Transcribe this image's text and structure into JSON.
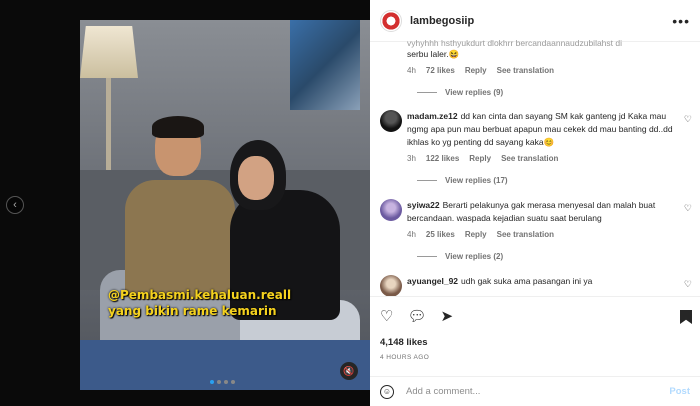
{
  "post": {
    "caption_line1": "@Pembasmi.kehaluan.reall",
    "caption_line2": "yang bikin rame kemarin"
  },
  "header": {
    "username": "lambegosiip",
    "more_label": "•••"
  },
  "comments": [
    {
      "text_tail": "serbu laler.😆",
      "time": "4h",
      "likes": "72 likes",
      "reply": "Reply",
      "see_translation": "See translation",
      "view_replies": "View replies (9)"
    },
    {
      "username": "madam.ze12",
      "text": "dd kan cinta dan sayang SM kak ganteng jd Kaka mau ngmg apa pun mau berbuat apapun mau cekek dd mau banting dd..dd ikhlas ko yg penting dd sayang kaka😊",
      "time": "3h",
      "likes": "122 likes",
      "reply": "Reply",
      "see_translation": "See translation",
      "view_replies": "View replies (17)"
    },
    {
      "username": "syiwa22",
      "text": "Berarti pelakunya gak merasa menyesal dan malah buat bercandaan. waspada kejadian suatu saat berulang",
      "time": "4h",
      "likes": "25 likes",
      "reply": "Reply",
      "see_translation": "See translation",
      "view_replies": "View replies (2)"
    },
    {
      "username": "ayuangel_92",
      "text": "udh gak suka ama pasangan ini ya"
    }
  ],
  "actions": {
    "likes": "4,148 likes",
    "time_ago": "4 HOURS AGO"
  },
  "add_comment": {
    "placeholder": "Add a comment...",
    "post_label": "Post"
  }
}
